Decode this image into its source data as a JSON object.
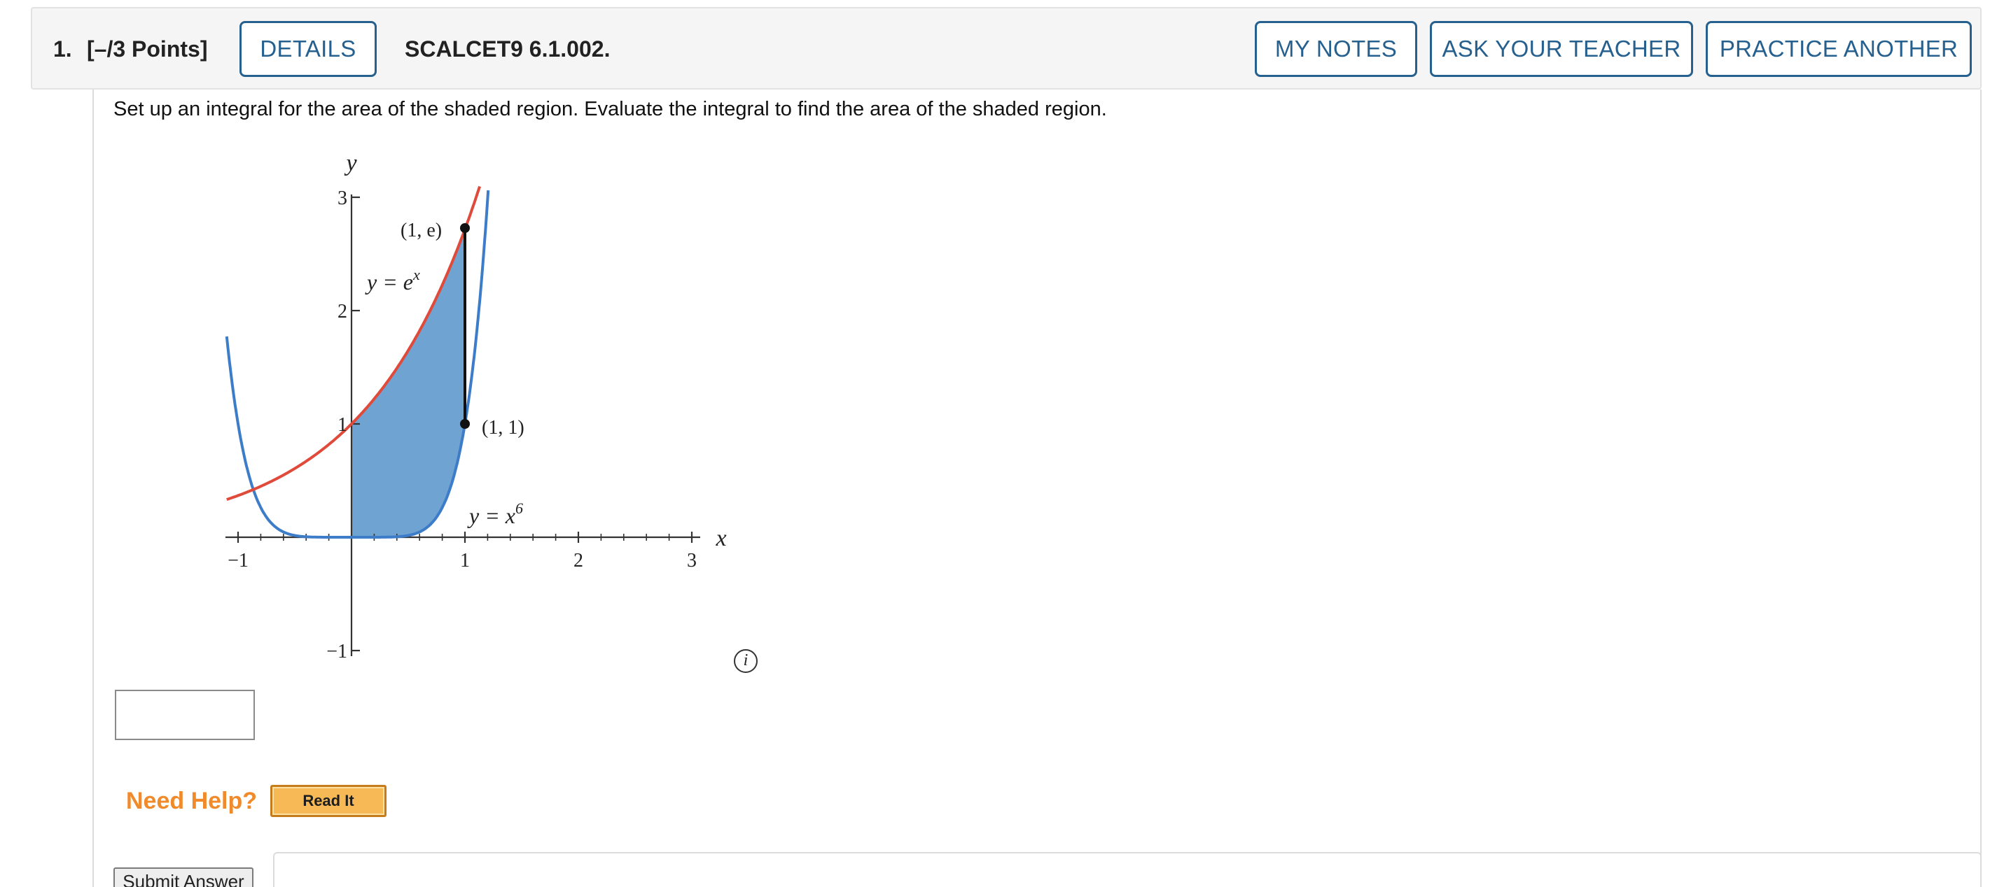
{
  "question": {
    "number": "1.",
    "points": "[–/3 Points]",
    "details_label": "DETAILS",
    "code": "SCALCET9 6.1.002.",
    "my_notes_label": "MY NOTES",
    "ask_teacher_label": "ASK YOUR TEACHER",
    "practice_label": "PRACTICE ANOTHER"
  },
  "prompt": "Set up an integral for the area of the shaded region. Evaluate the integral to find the area of the shaded region.",
  "graph": {
    "x_axis_label": "x",
    "y_axis_label": "y",
    "x_ticks": [
      "−1",
      "1",
      "2",
      "3"
    ],
    "y_ticks": [
      "3",
      "2",
      "1",
      "−1"
    ],
    "curve1_label_prefix": "y = e",
    "curve1_label_sup": "x",
    "curve2_label_prefix": "y = x",
    "curve2_label_sup": "6",
    "point_top_label": "(1, e)",
    "point_bottom_label": "(1, 1)",
    "colors": {
      "exp_curve": "#e04a3a",
      "power_curve": "#3d7cc9",
      "shaded": "#6fa3d2"
    }
  },
  "answer": {
    "value": ""
  },
  "help": {
    "need_help_label": "Need Help?",
    "read_it_label": "Read It"
  },
  "submit_label": "Submit Answer",
  "icons": {
    "info": "info-icon"
  }
}
